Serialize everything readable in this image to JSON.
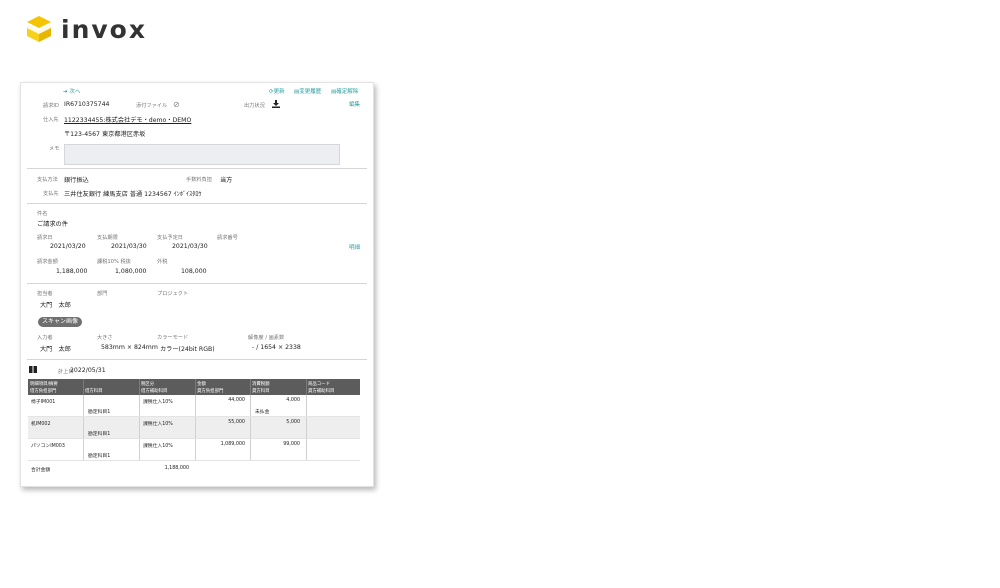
{
  "brand": {
    "name": "invox",
    "colors": {
      "accent": "#2a9fa0",
      "logo": "#f5c400"
    }
  },
  "top": {
    "next": "次へ",
    "update": "更新",
    "history": "変更履歴",
    "unconfirm": "確定解除",
    "edit": "編集"
  },
  "invoice": {
    "id_label": "請求ID",
    "id_value": "IR6710375744",
    "attach_label": "添付ファイル",
    "output_label": "出力状況",
    "vendor_label": "仕入先",
    "vendor_value": "1122334455:株式会社デモ・demo・DEMO",
    "address": "〒123-4567 東京都港区赤坂",
    "memo_label": "メモ",
    "payment_method_label": "支払方法",
    "payment_method_value": "銀行振込",
    "fee_label": "手数料負担",
    "fee_value": "当方",
    "payee_label": "支払先",
    "payee_value": "三井住友銀行 練馬支店 普通 1234567 ｲﾝﾎﾞｲｽﾀﾛｳ",
    "subject_label": "件名",
    "subject_value": "ご請求の件",
    "invoice_date_label": "請求日",
    "invoice_date": "2021/03/20",
    "due_date_label": "支払期限",
    "due_date": "2021/03/30",
    "planned_date_label": "支払予定日",
    "planned_date": "2021/03/30",
    "invoice_no_label": "請求番号",
    "detail_link": "明細",
    "amount_label": "請求金額",
    "amount": "1,188,000",
    "tax10_label": "課税10% 税抜",
    "tax10": "1,080,000",
    "tax_outer_label": "外税",
    "tax_outer": "108,000",
    "assignee_label": "担当者",
    "assignee": "大門　太郎",
    "dept_label": "部門",
    "project_label": "プロジェクト",
    "scan_chip": "スキャン画像",
    "inputter_label": "入力者",
    "inputter": "大門　太郎",
    "size_label": "大きさ",
    "size": "583mm × 824mm",
    "color_mode_label": "カラーモード",
    "color_mode": "カラー(24bit RGB)",
    "resolution_label": "解像度 / 画素数",
    "resolution": "- / 1654 × 2338",
    "post_date_label": "計上日",
    "post_date": "2022/05/31"
  },
  "table": {
    "headers": [
      [
        "明細項目/摘要",
        "借方負担部門"
      ],
      [
        "",
        "借方科目"
      ],
      [
        "税区分",
        "借方補助科目"
      ],
      [
        "金額",
        "貸方負担部門"
      ],
      [
        "消費税額",
        "貸方科目"
      ],
      [
        "商品コード",
        "貸方補助科目"
      ]
    ],
    "rows": [
      {
        "item": "椅子IM001",
        "sub": "勘定科目1",
        "tax": "課税仕入10%",
        "amount": "44,000",
        "vat": "4,000",
        "credit": "未払金"
      },
      {
        "item": "机IM002",
        "sub": "勘定科目1",
        "tax": "課税仕入10%",
        "amount": "55,000",
        "vat": "5,000",
        "credit": ""
      },
      {
        "item": "パソコンIM003",
        "sub": "勘定科目1",
        "tax": "課税仕入10%",
        "amount": "1,089,000",
        "vat": "99,000",
        "credit": ""
      }
    ],
    "total_label": "合計金額",
    "total_value": "1,188,000"
  }
}
